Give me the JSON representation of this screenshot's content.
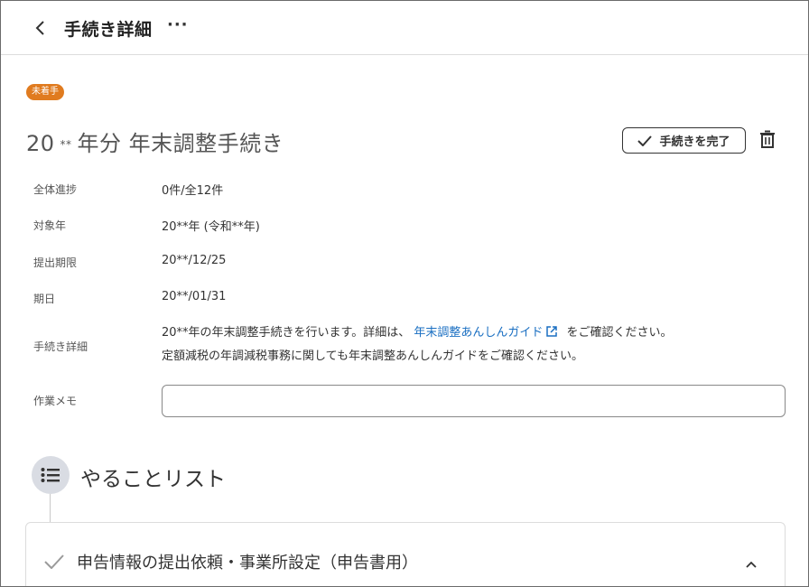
{
  "header": {
    "title": "手続き詳細",
    "more_label": "···"
  },
  "status_badge": "未着手",
  "procedure": {
    "title_prefix": "20",
    "title_mask": "**",
    "title_suffix": "年分 年末調整手続き",
    "complete_button": "手続きを完了"
  },
  "details": {
    "progress_label": "全体進捗",
    "progress_value": "0件/全12件",
    "year_label": "対象年",
    "year_value": "20**年 (令和**年)",
    "deadline_label": "提出期限",
    "deadline_value": "20**/12/25",
    "due_label": "期日",
    "due_value": "20**/01/31",
    "detail_label": "手続き詳細",
    "detail_line1_before": "20**年の年末調整手続きを行います。詳細は、",
    "detail_link": "年末調整あんしんガイド",
    "detail_line1_after": "をご確認ください。",
    "detail_line2": "定額減税の年調減税事務に関しても年末調整あんしんガイドをご確認ください。",
    "memo_label": "作業メモ",
    "memo_value": ""
  },
  "todo": {
    "title": "やることリスト",
    "tasks": [
      {
        "title": "申告情報の提出依頼・事業所設定（申告書用）"
      }
    ]
  },
  "colors": {
    "badge": "#e07b1f",
    "link": "#1a6fc2",
    "todo_icon_bg": "#d9dce3"
  }
}
